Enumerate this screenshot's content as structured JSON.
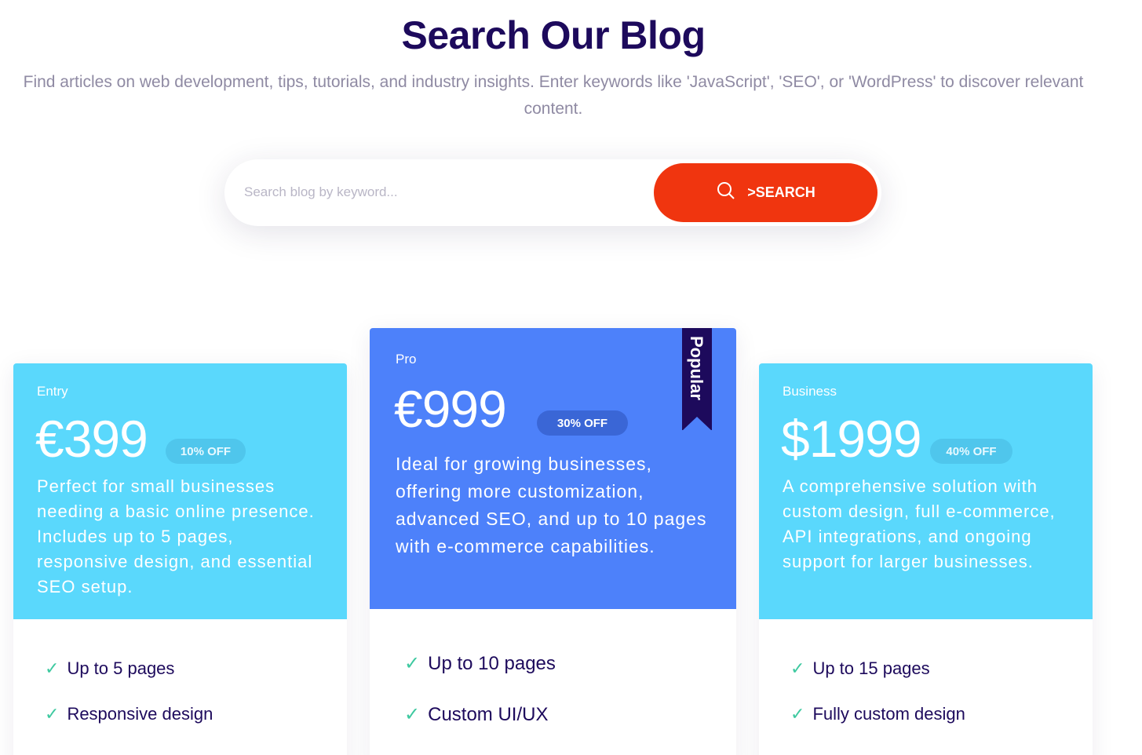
{
  "header": {
    "title": "Search Our Blog",
    "description": "Find articles on web development, tips, tutorials, and industry insights. Enter keywords like 'JavaScript', 'SEO', or 'WordPress' to discover relevant content."
  },
  "search": {
    "placeholder": "Search blog by keyword...",
    "button_label": ">SEARCH",
    "icon": "search-icon"
  },
  "colors": {
    "title": "#1d0a5c",
    "search_button": "#f0350f",
    "light_card": "#5ad8fc",
    "pro_card": "#4d81fa",
    "check": "#3ec9a0"
  },
  "plans": [
    {
      "tier": "Entry",
      "price": "€399",
      "discount": "10% OFF",
      "description": "Perfect for small businesses needing a basic online presence. Includes up to 5 pages, responsive design, and essential SEO setup.",
      "features": [
        "Up to 5 pages",
        "Responsive design"
      ]
    },
    {
      "tier": "Pro",
      "price": "€999",
      "discount": "30% OFF",
      "ribbon": "Popular",
      "description": "Ideal for growing businesses, offering more customization, advanced SEO, and up to 10 pages with e-commerce capabilities.",
      "features": [
        "Up to 10 pages",
        "Custom UI/UX"
      ]
    },
    {
      "tier": "Business",
      "price": "$1999",
      "discount": "40% OFF",
      "description": "A comprehensive solution with custom design, full e-commerce, API integrations, and ongoing support for larger businesses.",
      "features": [
        "Up to 15 pages",
        "Fully custom design"
      ]
    }
  ]
}
